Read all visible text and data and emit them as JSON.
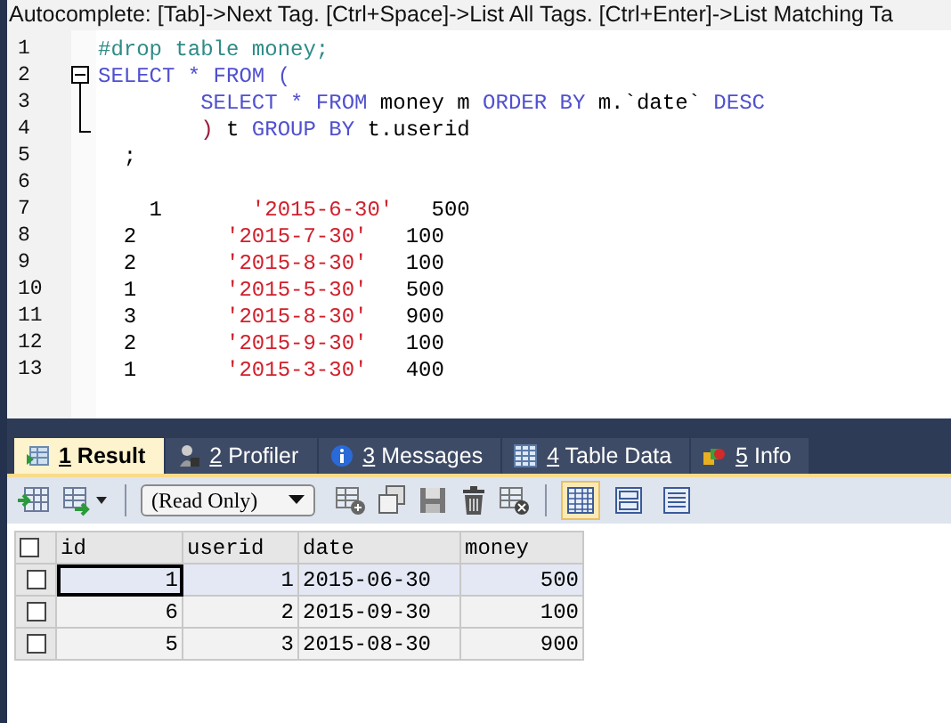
{
  "hint_bar": {
    "text": "Autocomplete: [Tab]->Next Tag. [Ctrl+Space]->List All Tags. [Ctrl+Enter]->List Matching Ta"
  },
  "editor": {
    "lines": [
      {
        "number": "1",
        "tokens": [
          {
            "kind": "comment",
            "text": "#drop table money;"
          }
        ]
      },
      {
        "number": "2",
        "kind": "fold_start",
        "tokens": [
          {
            "kind": "keyword",
            "text": "SELECT * FROM ("
          }
        ]
      },
      {
        "number": "3",
        "kind": "fold_inner",
        "tokens": [
          {
            "kind": "keyword",
            "text": "        SELECT * FROM"
          },
          {
            "kind": "plain",
            "text": " money m "
          },
          {
            "kind": "keyword",
            "text": "ORDER BY"
          },
          {
            "kind": "plain",
            "text": " m.`date` "
          },
          {
            "kind": "keyword",
            "text": "DESC"
          }
        ]
      },
      {
        "number": "4",
        "kind": "fold_end",
        "tokens": [
          {
            "kind": "paren",
            "text": "        )"
          },
          {
            "kind": "plain",
            "text": " t "
          },
          {
            "kind": "keyword",
            "text": "GROUP BY"
          },
          {
            "kind": "plain",
            "text": " t.userid"
          }
        ]
      },
      {
        "number": "5",
        "tokens": [
          {
            "kind": "plain",
            "text": "  ;"
          }
        ]
      },
      {
        "number": "6"
      },
      {
        "number": "7",
        "tokens": [
          {
            "kind": "plain",
            "text": "    1       "
          },
          {
            "kind": "string",
            "text": "'2015-6-30'"
          },
          {
            "kind": "plain",
            "text": "   500"
          }
        ]
      },
      {
        "number": "8",
        "tokens": [
          {
            "kind": "plain",
            "text": "  2       "
          },
          {
            "kind": "string",
            "text": "'2015-7-30'"
          },
          {
            "kind": "plain",
            "text": "   100"
          }
        ]
      },
      {
        "number": "9",
        "tokens": [
          {
            "kind": "plain",
            "text": "  2       "
          },
          {
            "kind": "string",
            "text": "'2015-8-30'"
          },
          {
            "kind": "plain",
            "text": "   100"
          }
        ]
      },
      {
        "number": "10",
        "tokens": [
          {
            "kind": "plain",
            "text": "  1       "
          },
          {
            "kind": "string",
            "text": "'2015-5-30'"
          },
          {
            "kind": "plain",
            "text": "   500"
          }
        ]
      },
      {
        "number": "11",
        "tokens": [
          {
            "kind": "plain",
            "text": "  3       "
          },
          {
            "kind": "string",
            "text": "'2015-8-30'"
          },
          {
            "kind": "plain",
            "text": "   900"
          }
        ]
      },
      {
        "number": "12",
        "tokens": [
          {
            "kind": "plain",
            "text": "  2       "
          },
          {
            "kind": "string",
            "text": "'2015-9-30'"
          },
          {
            "kind": "plain",
            "text": "   100"
          }
        ]
      },
      {
        "number": "13",
        "tokens": [
          {
            "kind": "plain",
            "text": "  1       "
          },
          {
            "kind": "string",
            "text": "'2015-3-30'"
          },
          {
            "kind": "plain",
            "text": "   400"
          }
        ]
      }
    ]
  },
  "tabs": [
    {
      "kind": "result",
      "key": "1",
      "label": "Result",
      "selected": true
    },
    {
      "kind": "profiler",
      "key": "2",
      "label": "Profiler",
      "selected": false
    },
    {
      "kind": "messages",
      "key": "3",
      "label": "Messages",
      "selected": false
    },
    {
      "kind": "tabledata",
      "key": "4",
      "label": "Table Data",
      "selected": false
    },
    {
      "kind": "info",
      "key": "5",
      "label": "Info",
      "selected": false
    }
  ],
  "toolbar": {
    "mode_dropdown": {
      "value": "(Read Only)"
    },
    "view_buttons": [
      {
        "kind": "grid",
        "selected": true
      },
      {
        "kind": "form",
        "selected": false
      },
      {
        "kind": "text",
        "selected": false
      }
    ]
  },
  "result_grid": {
    "all_checked": false,
    "columns": [
      "id",
      "userid",
      "date",
      "money"
    ],
    "rows": [
      {
        "checked": false,
        "selected": true,
        "cells": [
          "1",
          "1",
          "2015-06-30",
          "500"
        ]
      },
      {
        "checked": false,
        "selected": false,
        "cells": [
          "6",
          "2",
          "2015-09-30",
          "100"
        ]
      },
      {
        "checked": false,
        "selected": false,
        "cells": [
          "5",
          "3",
          "2015-08-30",
          "900"
        ]
      }
    ]
  }
}
